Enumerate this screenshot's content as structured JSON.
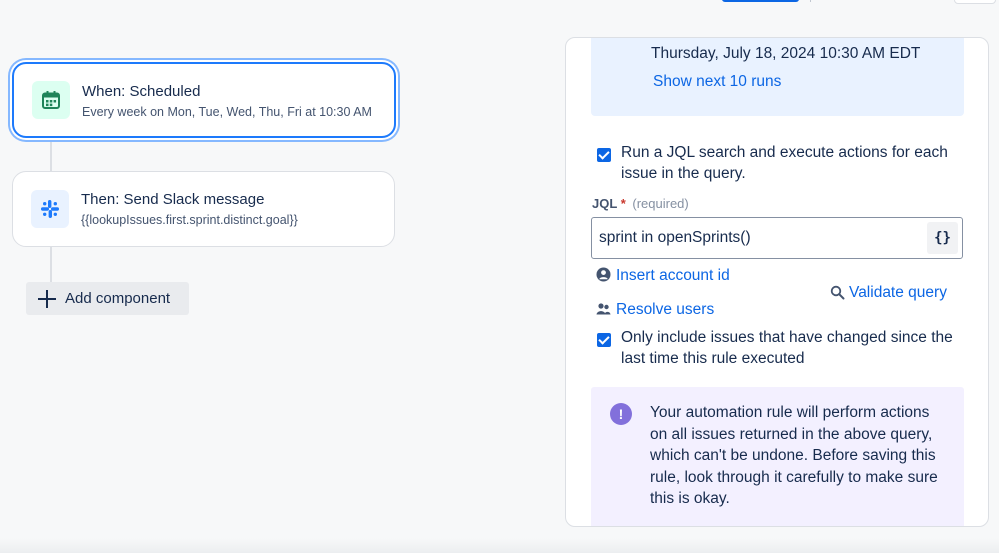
{
  "flow": {
    "trigger": {
      "title": "When: Scheduled",
      "subtitle": "Every week on Mon, Tue, Wed, Thu, Fri at 10:30 AM",
      "icon": "calendar-icon",
      "icon_color": "#1f845a",
      "icon_bg": "#dcfff1"
    },
    "action": {
      "title": "Then: Send Slack message",
      "subtitle": "{{lookupIssues.first.sprint.distinct.goal}}",
      "icon": "slack-icon",
      "icon_bg": "#e9f2ff"
    },
    "add_component_label": "Add component"
  },
  "panel": {
    "schedule": {
      "date": "Thursday, July 18, 2024 10:30 AM EDT",
      "show_runs": "Show next 10 runs"
    },
    "run_jql": {
      "checked": true,
      "label": "Run a JQL search and execute actions for each issue in the query."
    },
    "jql": {
      "label": "JQL",
      "required_mark": "*",
      "hint": "(required)",
      "value": "sprint in openSprints()",
      "brace_button": "{}"
    },
    "insert_account_id": "Insert account id",
    "resolve_users": "Resolve users",
    "validate_query": "Validate query",
    "only_changed": {
      "checked": true,
      "label": "Only include issues that have changed since the last time this rule executed"
    },
    "warning": {
      "icon_glyph": "!",
      "text": "Your automation rule will perform actions on all issues returned in the above query, which can't be undone. Before saving this rule, look through it carefully to make sure this is okay."
    }
  },
  "colors": {
    "accent": "#0c66e4",
    "selected_border": "#1d7afc",
    "info_bg": "#e9f2ff",
    "warning_bg": "#f3f0ff",
    "warning_icon": "#8270db"
  }
}
